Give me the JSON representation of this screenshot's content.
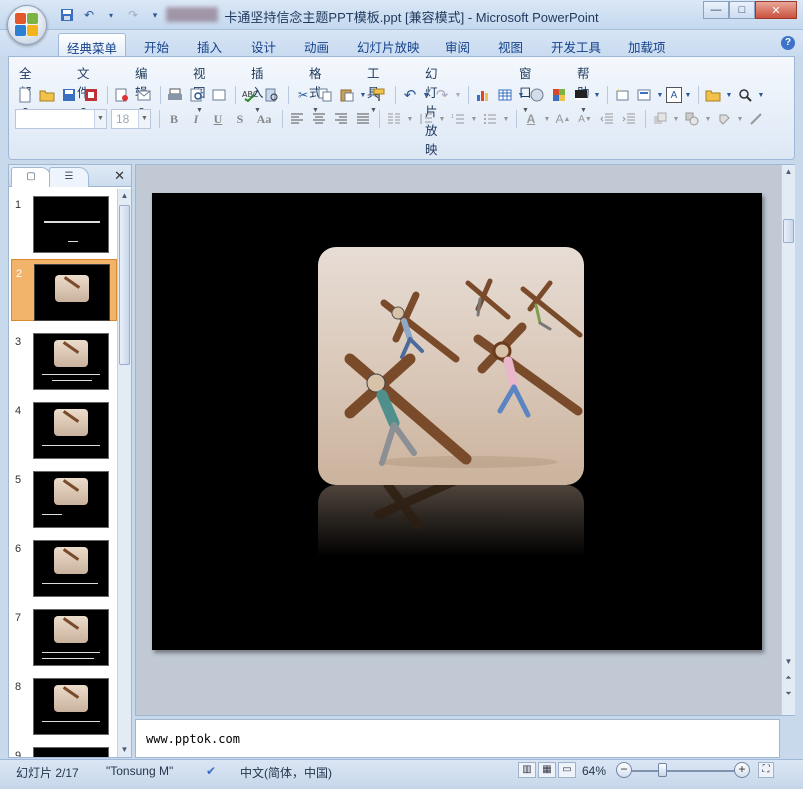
{
  "window": {
    "title": "卡通坚持信念主题PPT模板.ppt [兼容模式] - Microsoft PowerPoint",
    "controls": {
      "minimize": "—",
      "maximize": "□",
      "close": "✕"
    }
  },
  "qat": {
    "save_icon": "save-icon",
    "undo": "↶",
    "redo": "↷",
    "customize": "▾"
  },
  "ribbon_tabs": [
    "经典菜单",
    "开始",
    "插入",
    "设计",
    "动画",
    "幻灯片放映",
    "审阅",
    "视图",
    "开发工具",
    "加载项"
  ],
  "help": "?",
  "menus": [
    "全部",
    "文件",
    "编辑",
    "视图",
    "插入",
    "格式",
    "工具",
    "幻灯片放映",
    "窗口",
    "帮助"
  ],
  "font": {
    "name_value": "",
    "size_value": "18"
  },
  "format_buttons": {
    "bold": "B",
    "italic": "I",
    "underline": "U",
    "shadow": "S",
    "case": "Aa"
  },
  "slides_panel": {
    "tab_slides": "▢",
    "tab_outline": "☰",
    "close": "✕",
    "slides": [
      {
        "num": "1"
      },
      {
        "num": "2"
      },
      {
        "num": "3"
      },
      {
        "num": "4"
      },
      {
        "num": "5"
      },
      {
        "num": "6"
      },
      {
        "num": "7"
      },
      {
        "num": "8"
      },
      {
        "num": "9"
      }
    ],
    "selected_index": 1
  },
  "notes": {
    "text": "www.pptok.com"
  },
  "status": {
    "slide_info": "幻灯片 2/17",
    "theme": "\"Tonsung M\"",
    "language": "中文(简体，中国)",
    "zoom": "64%",
    "zoom_out": "−",
    "zoom_in": "+"
  }
}
